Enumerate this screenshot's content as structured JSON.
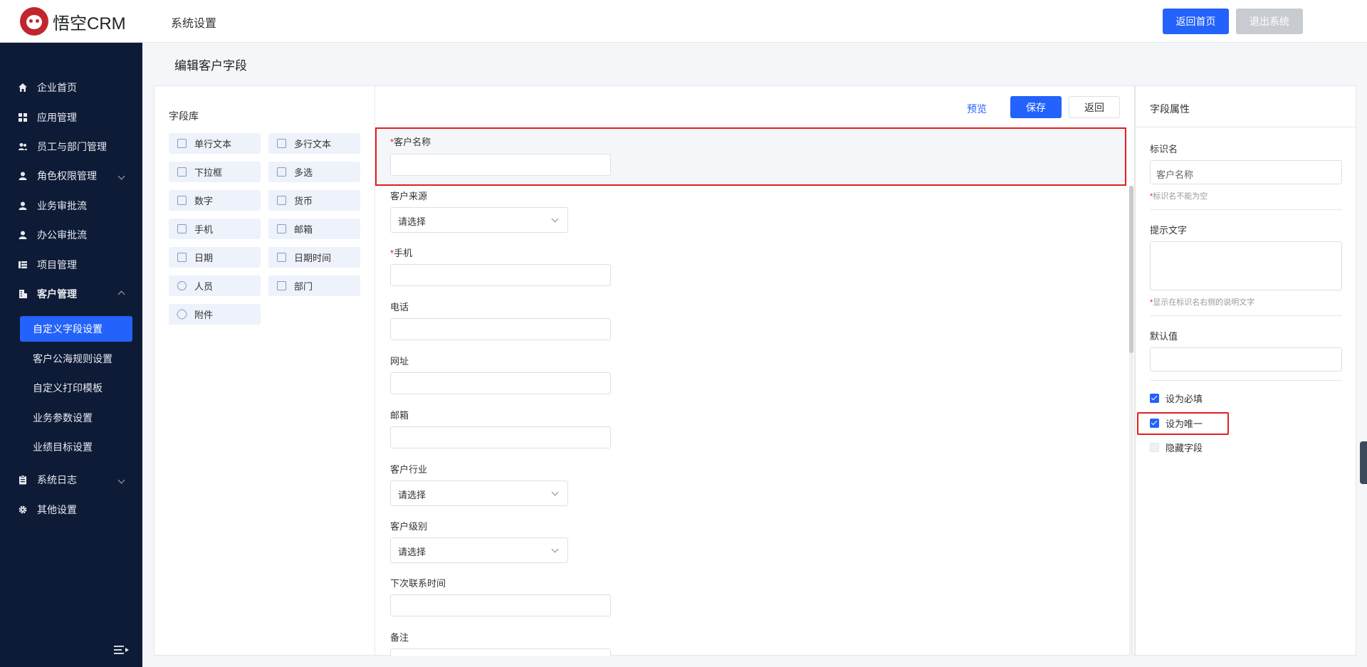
{
  "header": {
    "logo_text": "悟空CRM",
    "section_title": "系统设置",
    "home_button": "返回首页",
    "exit_button": "退出系统"
  },
  "sidebar": {
    "items": [
      {
        "label": "企业首页",
        "icon": "home-icon"
      },
      {
        "label": "应用管理",
        "icon": "grid-icon"
      },
      {
        "label": "员工与部门管理",
        "icon": "users-icon"
      },
      {
        "label": "角色权限管理",
        "icon": "user-icon",
        "expandable": true
      },
      {
        "label": "业务审批流",
        "icon": "user-icon"
      },
      {
        "label": "办公审批流",
        "icon": "user-icon"
      },
      {
        "label": "项目管理",
        "icon": "list-icon"
      },
      {
        "label": "客户管理",
        "icon": "building-icon",
        "expanded": true
      },
      {
        "label": "系统日志",
        "icon": "clipboard-icon",
        "expandable": true
      },
      {
        "label": "其他设置",
        "icon": "gear-icon"
      }
    ],
    "sub_items": [
      {
        "label": "自定义字段设置",
        "active": true
      },
      {
        "label": "客户公海规则设置"
      },
      {
        "label": "自定义打印模板"
      },
      {
        "label": "业务参数设置"
      },
      {
        "label": "业绩目标设置"
      }
    ]
  },
  "page_title": "编辑客户字段",
  "library": {
    "title": "字段库",
    "fields": [
      "单行文本",
      "多行文本",
      "下拉框",
      "多选",
      "数字",
      "货币",
      "手机",
      "邮箱",
      "日期",
      "日期时间",
      "人员",
      "部门",
      "附件"
    ]
  },
  "form": {
    "preview_label": "预览",
    "save_label": "保存",
    "back_label": "返回",
    "fields": [
      {
        "label": "客户名称",
        "required": true,
        "type": "input"
      },
      {
        "label": "客户来源",
        "required": false,
        "type": "select",
        "value": "请选择"
      },
      {
        "label": "手机",
        "required": true,
        "type": "input"
      },
      {
        "label": "电话",
        "required": false,
        "type": "input"
      },
      {
        "label": "网址",
        "required": false,
        "type": "input"
      },
      {
        "label": "邮箱",
        "required": false,
        "type": "input"
      },
      {
        "label": "客户行业",
        "required": false,
        "type": "select",
        "value": "请选择"
      },
      {
        "label": "客户级别",
        "required": false,
        "type": "select",
        "value": "请选择"
      },
      {
        "label": "下次联系时间",
        "required": false,
        "type": "input"
      },
      {
        "label": "备注",
        "required": false,
        "type": "input"
      }
    ]
  },
  "attributes": {
    "title": "字段属性",
    "name_label": "标识名",
    "name_value": "客户名称",
    "name_hint": "标识名不能为空",
    "tip_label": "提示文字",
    "tip_hint": "显示在标识名右侧的说明文字",
    "default_label": "默认值",
    "required_label": "设为必填",
    "required_checked": true,
    "unique_label": "设为唯一",
    "unique_checked": true,
    "hidden_label": "隐藏字段",
    "hidden_checked": false,
    "required_mark": "*"
  },
  "colors": {
    "primary": "#2362fb",
    "sidebar_bg": "#0d1b36",
    "highlight": "#e02020"
  }
}
